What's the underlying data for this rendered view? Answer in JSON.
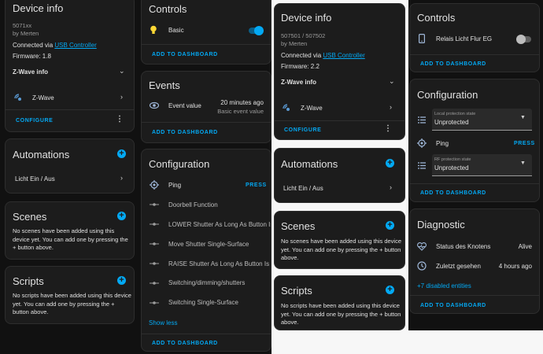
{
  "col1": {
    "device_info": {
      "title": "Device info",
      "model": "5071xx",
      "manufacturer": "by Merten",
      "connected_prefix": "Connected via ",
      "connected_link": "USB Controller",
      "firmware": "Firmware: 1.8",
      "zwave_info": "Z-Wave info",
      "zwave_item": "Z-Wave",
      "configure": "CONFIGURE"
    },
    "automations": {
      "title": "Automations",
      "item": "Licht Ein / Aus"
    },
    "scenes": {
      "title": "Scenes",
      "empty": "No scenes have been added using this device yet. You can add one by pressing the + button above."
    },
    "scripts": {
      "title": "Scripts",
      "empty": "No scripts have been added using this device yet. You can add one by pressing the + button above."
    }
  },
  "col2": {
    "controls": {
      "title": "Controls",
      "item": "Basic",
      "add": "ADD TO DASHBOARD"
    },
    "events": {
      "title": "Events",
      "item": "Event value",
      "time": "20 minutes ago",
      "detail": "Basic event value",
      "add": "ADD TO DASHBOARD"
    },
    "configuration": {
      "title": "Configuration",
      "ping": "Ping",
      "press": "PRESS",
      "items": [
        "Doorbell Function",
        "LOWER Shutter As Long As Button Is",
        "Move Shutter Single-Surface",
        "RAISE Shutter As Long As Button Is I",
        "Switching/dimming/shutters",
        "Switching Single-Surface"
      ],
      "show_less": "Show less",
      "add": "ADD TO DASHBOARD"
    }
  },
  "col3": {
    "device_info": {
      "title": "Device info",
      "model": "507501 / 507502",
      "manufacturer": "by Merten",
      "connected_prefix": "Connected via ",
      "connected_link": "USB Controller",
      "firmware": "Firmware: 2.2",
      "zwave_info": "Z-Wave info",
      "zwave_item": "Z-Wave",
      "configure": "CONFIGURE"
    },
    "automations": {
      "title": "Automations",
      "item": "Licht Ein / Aus"
    },
    "scenes": {
      "title": "Scenes",
      "empty": "No scenes have been added using this device yet. You can add one by pressing the + button above."
    },
    "scripts": {
      "title": "Scripts",
      "empty": "No scripts have been added using this device yet. You can add one by pressing the + button above."
    }
  },
  "col4": {
    "controls": {
      "title": "Controls",
      "item": "Relais Licht Flur EG",
      "add": "ADD TO DASHBOARD"
    },
    "configuration": {
      "title": "Configuration",
      "local_label": "Local protection state",
      "local_value": "Unprotected",
      "ping": "Ping",
      "press": "PRESS",
      "rf_label": "RF protection state",
      "rf_value": "Unprotected",
      "add": "ADD TO DASHBOARD"
    },
    "diagnostic": {
      "title": "Diagnostic",
      "status_label": "Status des Knotens",
      "status_value": "Alive",
      "seen_label": "Zuletzt gesehen",
      "seen_value": "4 hours ago",
      "disabled": "+7 disabled entities",
      "add": "ADD TO DASHBOARD"
    }
  },
  "colors": {
    "accent": "#03a9f4",
    "card": "#1c1c1c",
    "background": "#111111",
    "toggle_off": "#9e9e9e"
  }
}
